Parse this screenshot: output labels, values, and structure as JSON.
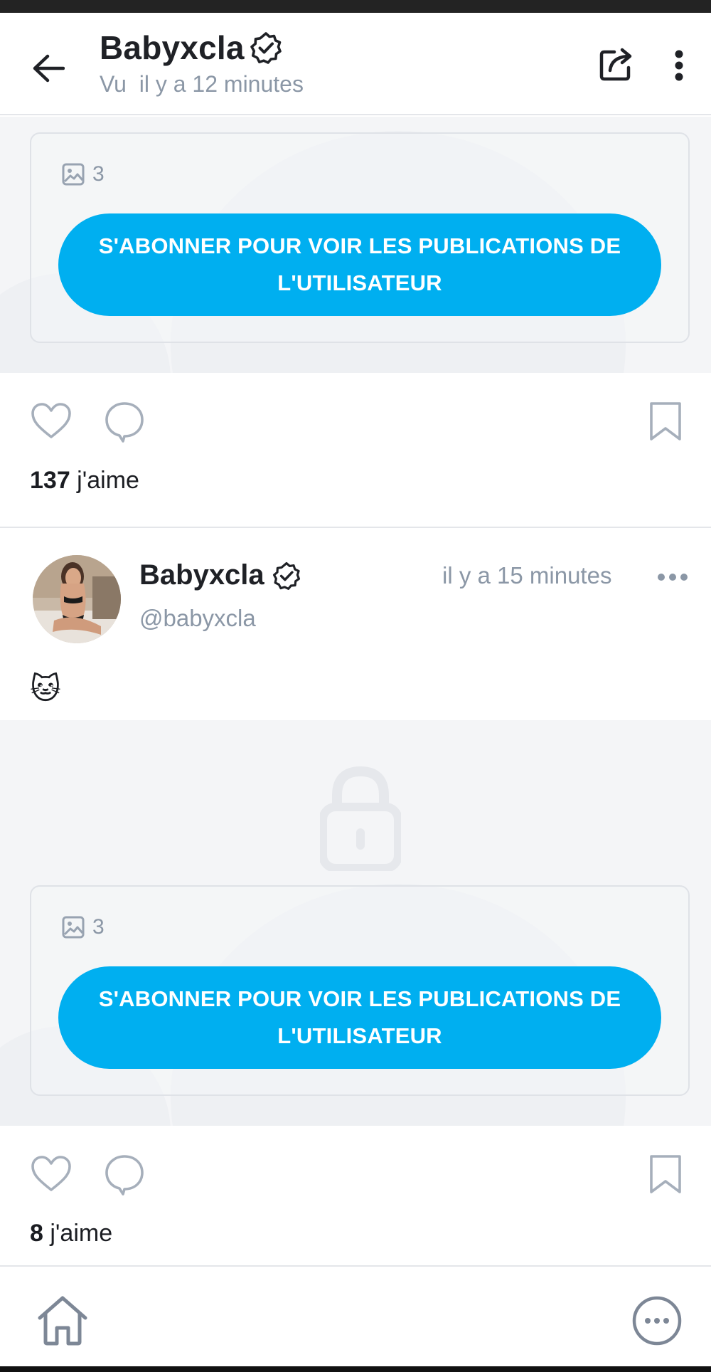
{
  "header": {
    "name": "Babyxcla",
    "seen_status": "Vu  il y a 12 minutes"
  },
  "locked_post_1": {
    "media_count": "3",
    "subscribe_label": "S'ABONNER POUR VOIR LES PUBLICATIONS DE L'UTILISATEUR",
    "likes_count": "137",
    "likes_suffix": " j'aime"
  },
  "post_2": {
    "author_name": "Babyxcla",
    "handle": "@babyxcla",
    "time": "il y a 15 minutes",
    "text": "🐱",
    "media_count": "3",
    "subscribe_label": "S'ABONNER POUR VOIR LES PUBLICATIONS DE L'UTILISATEUR",
    "likes_count": "8",
    "likes_suffix": " j'aime"
  },
  "icons": {
    "back": "arrow-left-icon",
    "verified": "verified-badge-icon",
    "share": "share-icon",
    "more_vertical": "more-vertical-icon",
    "image": "image-icon",
    "like": "heart-icon",
    "comment": "comment-icon",
    "bookmark": "bookmark-icon",
    "more_horizontal": "more-horizontal-icon",
    "lock": "lock-icon",
    "home": "home-icon",
    "more_circle": "more-circle-icon"
  },
  "colors": {
    "accent": "#00aff0",
    "muted_text": "#8b97a6",
    "locked_background": "#f4f5f7",
    "icon_gray": "#a6afbb"
  }
}
